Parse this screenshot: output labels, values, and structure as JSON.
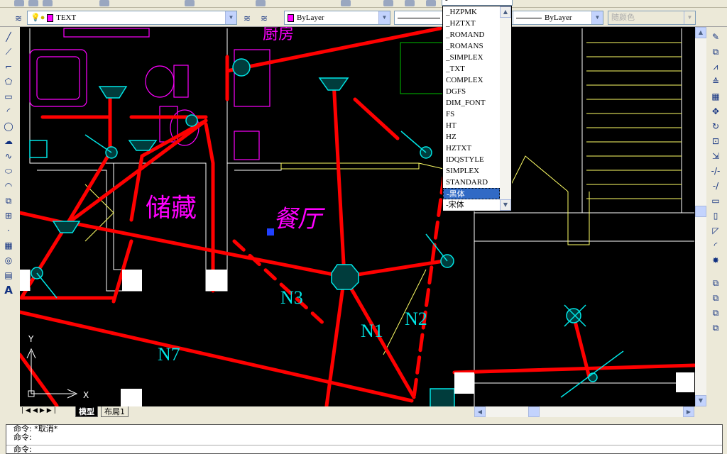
{
  "toolbar_top": {
    "textstyle_value": "-",
    "icons": [
      "new-icon",
      "open-icon",
      "save-icon",
      "print-icon",
      "undo-icon",
      "redo-icon",
      "pan-icon",
      "zoom-icon",
      "properties-icon",
      "help-icon"
    ]
  },
  "layers_toolbar": {
    "layer_value": "TEXT",
    "layer_color": "#ff00ff"
  },
  "properties_toolbar": {
    "color_value": "ByLayer",
    "linetype_value": "",
    "lineweight_value": "ByLayer",
    "plotstyle_value": "随颜色"
  },
  "font_dropdown": {
    "items": [
      "_HZPMK",
      "_HZTXT",
      "_ROMAND",
      "_ROMANS",
      "_SIMPLEX",
      "_TXT",
      "COMPLEX",
      "DGFS",
      "DIM_FONT",
      "FS",
      "HT",
      "HZ",
      "HZTXT",
      "IDQSTYLE",
      "SIMPLEX",
      "STANDARD",
      "-黑体",
      "-宋体"
    ],
    "selected": "-黑体"
  },
  "drawing": {
    "labels": {
      "storage": "储藏",
      "dining": "餐厅",
      "kitchen": "厨房",
      "n1": "N1",
      "n2": "N2",
      "n3": "N3",
      "n7": "N7"
    },
    "axis_y": "Y",
    "axis_x": "X",
    "colors": {
      "wire": "#ff0000",
      "fixture": "#00e5e5",
      "room_text": "#ff00ff",
      "wall": "#ffffff"
    }
  },
  "tabs": [
    {
      "label": "模型"
    },
    {
      "label": "布局1"
    }
  ],
  "command": {
    "lines": [
      "命令: *取消*",
      "命令:"
    ],
    "prompt": "命令:"
  }
}
